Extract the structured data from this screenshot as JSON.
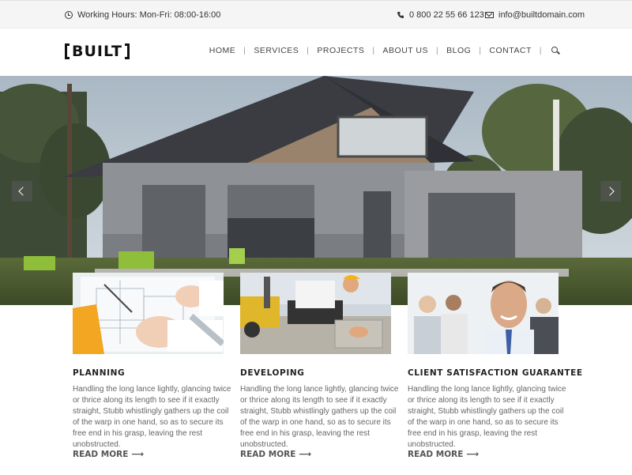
{
  "topbar": {
    "hours": "Working Hours: Mon-Fri: 08:00-16:00",
    "phone": "0 800 22 55 66 123",
    "email": "info@builtdomain.com"
  },
  "brand": {
    "logo": "BUILT"
  },
  "nav": {
    "items": [
      "HOME",
      "SERVICES",
      "PROJECTS",
      "ABOUT US",
      "BLOG",
      "CONTACT"
    ],
    "search_icon": "search-icon"
  },
  "hero": {
    "prev_icon": "chevron-left-icon",
    "next_icon": "chevron-right-icon"
  },
  "cards": [
    {
      "title": "PLANNING",
      "text": "Handling the long lance lightly, glancing twice or thrice along its length to see if it exactly straight, Stubb whistlingly gathers up the coil of the warp in one hand, so as to secure its free end in his grasp, leaving the rest unobstructed.",
      "more": "READ MORE"
    },
    {
      "title": "DEVELOPING",
      "text": "Handling the long lance lightly, glancing twice or thrice along its length to see if it exactly straight, Stubb whistlingly gathers up the coil of the warp in one hand, so as to secure its free end in his grasp, leaving the rest unobstructed.",
      "more": "READ MORE"
    },
    {
      "title": "CLIENT SATISFACTION GUARANTEE",
      "text": "Handling the long lance lightly, glancing twice or thrice along its length to see if it exactly straight, Stubb whistlingly gathers up the coil of the warp in one hand, so as to secure its free end in his grasp, leaving the rest unobstructed.",
      "more": "READ MORE"
    }
  ],
  "colors": {
    "topbar_bg": "#f5f5f5",
    "accent": "#222222"
  }
}
